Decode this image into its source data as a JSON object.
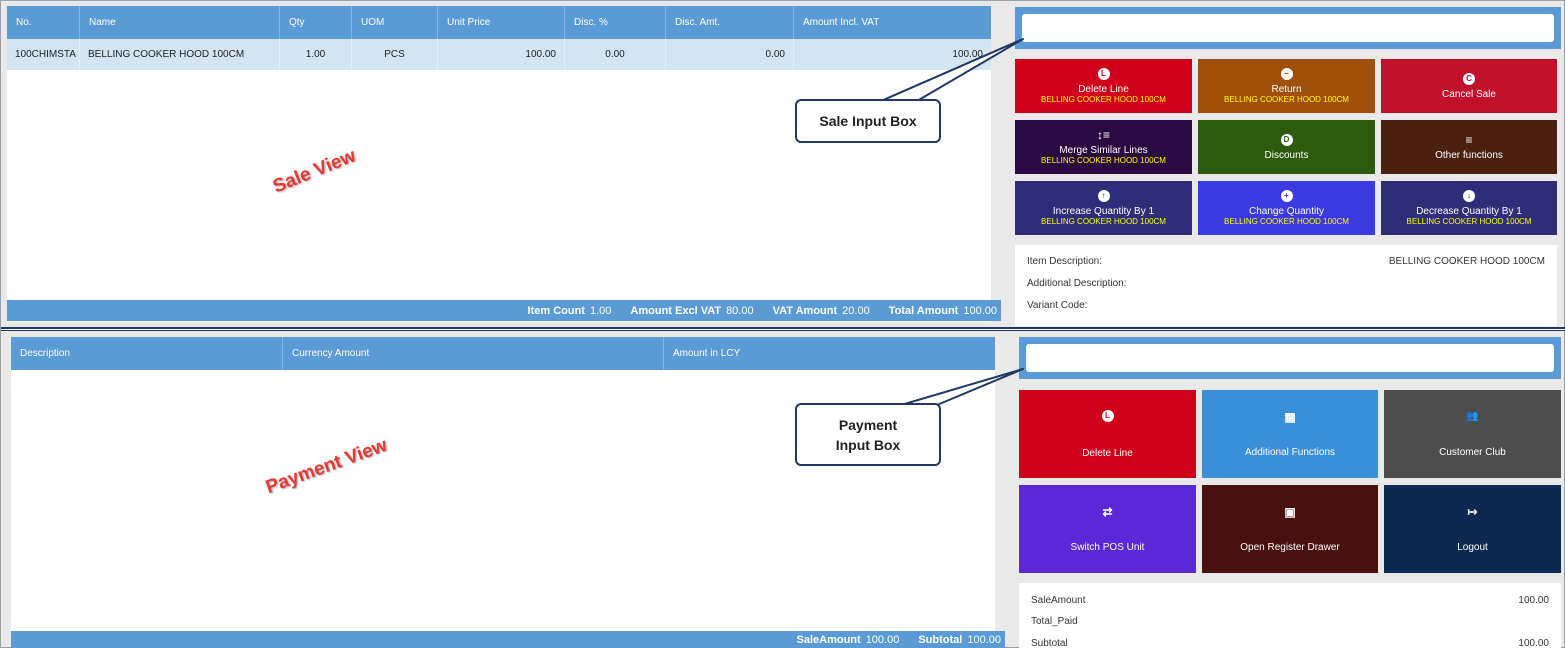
{
  "sale_grid": {
    "columns": [
      "No.",
      "Name",
      "Qty",
      "UOM",
      "Unit Price",
      "Disc. %",
      "Disc. Amt.",
      "Amount Incl. VAT"
    ],
    "rows": [
      {
        "no": "100CHIMSTA",
        "name": "BELLING COOKER HOOD 100CM",
        "qty": "1.00",
        "uom": "PCS",
        "unit_price": "100.00",
        "disc_pct": "0.00",
        "disc_amt": "0.00",
        "amount": "100.00"
      }
    ],
    "footer": {
      "item_count_label": "Item Count",
      "item_count": "1.00",
      "excl_vat_label": "Amount Excl VAT",
      "excl_vat": "80.00",
      "vat_label": "VAT Amount",
      "vat": "20.00",
      "total_label": "Total Amount",
      "total": "100.00"
    }
  },
  "sale_actions": [
    {
      "label": "Delete Line",
      "sub": "BELLING COOKER HOOD 100CM",
      "icon": "L",
      "color": "#d0021b"
    },
    {
      "label": "Return",
      "sub": "BELLING COOKER HOOD 100CM",
      "icon": "−",
      "color": "#a0500a"
    },
    {
      "label": "Cancel Sale",
      "sub": "",
      "icon": "C",
      "color": "#c0102a"
    },
    {
      "label": "Merge Similar Lines",
      "sub": "BELLING COOKER HOOD 100CM",
      "icon": "↕≡",
      "color": "#2a0a40"
    },
    {
      "label": "Discounts",
      "sub": "",
      "icon": "D",
      "color": "#2e5a0e"
    },
    {
      "label": "Other functions",
      "sub": "",
      "icon": "≡",
      "color": "#4a2010"
    },
    {
      "label": "Increase Quantity By 1",
      "sub": "BELLING COOKER HOOD 100CM",
      "icon": "↑",
      "color": "#2e2e78"
    },
    {
      "label": "Change Quantity",
      "sub": "BELLING COOKER HOOD 100CM",
      "icon": "+",
      "color": "#3a3ae0"
    },
    {
      "label": "Decrease Quantity By 1",
      "sub": "BELLING COOKER HOOD 100CM",
      "icon": "↓",
      "color": "#2e2e78"
    }
  ],
  "item_info": {
    "description_label": "Item Description:",
    "description_value": "BELLING COOKER HOOD 100CM",
    "additional_label": "Additional Description:",
    "variant_label": "Variant Code:"
  },
  "payment_grid": {
    "columns": [
      "Description",
      "Currency Amount",
      "Amount in LCY"
    ],
    "footer": {
      "sale_amount_label": "SaleAmount",
      "sale_amount": "100.00",
      "subtotal_label": "Subtotal",
      "subtotal": "100.00"
    }
  },
  "payment_actions": [
    {
      "label": "Delete Line",
      "icon": "L",
      "color": "#d0021b"
    },
    {
      "label": "Additional Functions",
      "icon": "▦",
      "color": "#3a8fd6"
    },
    {
      "label": "Customer Club",
      "icon": "👥",
      "color": "#4d4d4d"
    },
    {
      "label": "Switch POS Unit",
      "icon": "⇄",
      "color": "#5a28d6"
    },
    {
      "label": "Open Register Drawer",
      "icon": "▣",
      "color": "#4a1010"
    },
    {
      "label": "Logout",
      "icon": "↦",
      "color": "#0e2a52"
    }
  ],
  "payment_info": {
    "sale_amount_label": "SaleAmount",
    "sale_amount": "100.00",
    "total_paid_label": "Total_Paid",
    "subtotal_label": "Subtotal",
    "subtotal": "100.00"
  },
  "annotations": {
    "sale_view": "Sale View",
    "sale_input_box": "Sale Input Box",
    "payment_view": "Payment View",
    "payment_input_box_l1": "Payment",
    "payment_input_box_l2": "Input Box"
  }
}
